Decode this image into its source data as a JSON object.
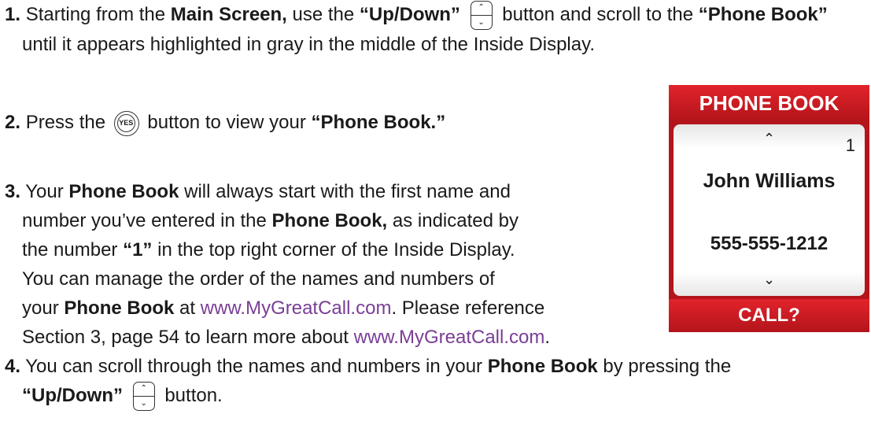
{
  "steps": {
    "s1": {
      "num": "1.",
      "a": "Starting from the",
      "b": "Main Screen,",
      "c": "use the",
      "d": "“Up/Down”",
      "e": "button and scroll to the",
      "f": "“Phone Book”",
      "g": "until it appears highlighted in gray in the middle of the Inside Display."
    },
    "s2": {
      "num": "2.",
      "a": "Press the",
      "b": "button to view your",
      "c": "“Phone Book.”"
    },
    "s3": {
      "num": "3.",
      "a": "Your",
      "b": "Phone Book",
      "c": "will always start with the first name and",
      "line2a": "number you’ve entered in the",
      "line2b": "Phone Book,",
      "line2c": "as indicated by",
      "line3a": "the number",
      "line3b": "“1”",
      "line3c": "in the top right corner of the Inside Display.",
      "line4": "You can manage the order of the names and numbers of",
      "line5a": "your",
      "line5b": "Phone Book",
      "line5c": "at",
      "link1": "www.MyGreatCall.com",
      "line5d": ". Please reference",
      "line6a": "Section 3, page 54 to learn more about",
      "link2": "www.MyGreatCall.com",
      "line6b": "."
    },
    "s4": {
      "num": "4.",
      "a": "You can scroll through the names and numbers in your",
      "b": "Phone Book",
      "c": "by pressing the",
      "d": "“Up/Down”",
      "e": "button."
    }
  },
  "icons": {
    "updown_up": "⌃",
    "updown_down": "⌄",
    "yes_label": "YES"
  },
  "phone": {
    "header": "PHONE BOOK",
    "up_arrow": "⌃",
    "index": "1",
    "name": "John Williams",
    "number": "555-555-1212",
    "down_arrow": "⌄",
    "footer": "CALL?"
  },
  "colors": {
    "header_red": "#e2232b",
    "link_purple": "#7a3e96"
  }
}
